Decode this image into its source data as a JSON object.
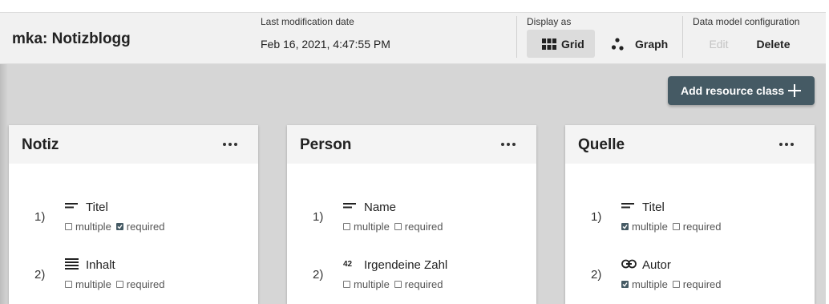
{
  "header": {
    "project_title": "mka: Notizblogg",
    "last_modified_label": "Last modification date",
    "last_modified_value": "Feb 16, 2021, 4:47:55 PM",
    "display_as_label": "Display as",
    "grid_label": "Grid",
    "graph_label": "Graph",
    "config_label": "Data model configuration",
    "edit_label": "Edit",
    "delete_label": "Delete"
  },
  "add_resource_label": "Add resource class",
  "option_labels": {
    "multiple": "multiple",
    "required": "required"
  },
  "cards": [
    {
      "title": "Notiz",
      "props": [
        {
          "num": "1)",
          "icon": "short-text-icon",
          "name": "Titel",
          "multiple": false,
          "required": true
        },
        {
          "num": "2)",
          "icon": "long-text-icon",
          "name": "Inhalt",
          "multiple": false,
          "required": false
        }
      ]
    },
    {
      "title": "Person",
      "props": [
        {
          "num": "1)",
          "icon": "short-text-icon",
          "name": "Name",
          "multiple": false,
          "required": false
        },
        {
          "num": "2)",
          "icon": "integer-icon",
          "icon_text": "42",
          "name": "Irgendeine Zahl",
          "multiple": false,
          "required": false
        }
      ]
    },
    {
      "title": "Quelle",
      "props": [
        {
          "num": "1)",
          "icon": "short-text-icon",
          "name": "Titel",
          "multiple": true,
          "required": false
        },
        {
          "num": "2)",
          "icon": "link-icon",
          "name": "Autor",
          "multiple": true,
          "required": false
        }
      ]
    }
  ],
  "colors": {
    "accent": "#455a64",
    "header_bg": "#f1f1f1",
    "canvas_bg": "#d6d6d6"
  }
}
